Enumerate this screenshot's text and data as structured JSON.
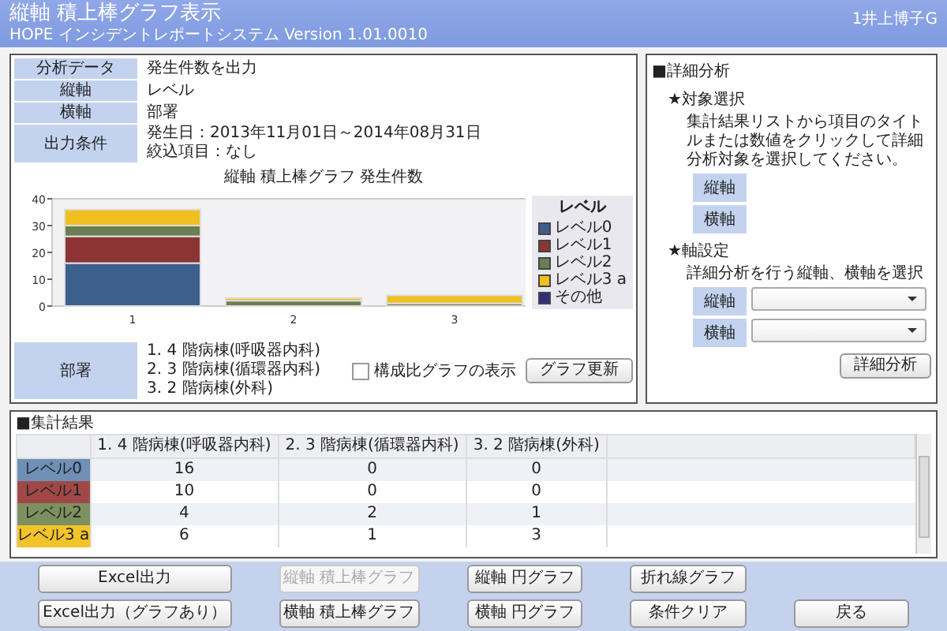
{
  "window": {
    "title": "縦軸 積上棒グラフ表示",
    "subtitle": "HOPE インシデントレポートシステム Version 1.01.0010",
    "user": "1井上博子G"
  },
  "conditions": [
    {
      "label": "分析データ",
      "lines": [
        "発生件数を出力"
      ]
    },
    {
      "label": "縦軸",
      "lines": [
        "レベル"
      ]
    },
    {
      "label": "横軸",
      "lines": [
        "部署"
      ]
    },
    {
      "label": "出力条件",
      "lines": [
        "発生日：2013年11月01日～2014年08月31日",
        "絞込項目：なし"
      ]
    }
  ],
  "chart": {
    "chart_data": {
      "type": "bar",
      "stacked": true,
      "title": "縦軸 積上棒グラフ  発生件数",
      "categories": [
        "1",
        "2",
        "3"
      ],
      "ylim": [
        0,
        40
      ],
      "yticks": [
        0,
        10,
        20,
        30,
        40
      ],
      "legend": {
        "title": "レベル"
      },
      "series": [
        {
          "name": "レベル0",
          "color": "#3d5f8c",
          "values": [
            16,
            0,
            0
          ]
        },
        {
          "name": "レベル1",
          "color": "#8c3434",
          "values": [
            10,
            0,
            0
          ]
        },
        {
          "name": "レベル2",
          "color": "#6b7e52",
          "values": [
            4,
            2,
            1
          ]
        },
        {
          "name": "レベル3 a",
          "color": "#f0c020",
          "values": [
            6,
            1,
            3
          ]
        },
        {
          "name": "その他",
          "color": "#2e2e7a",
          "values": [
            0,
            0,
            0
          ]
        }
      ]
    }
  },
  "department": {
    "label": "部署",
    "lines": [
      "1. 4 階病棟(呼吸器内科)",
      "2. 3 階病棟(循環器内科)",
      "3. 2 階病棟(外科)"
    ],
    "ratio_checkbox": {
      "label": "構成比グラフの表示",
      "checked": false
    },
    "update_button": "グラフ更新"
  },
  "detail": {
    "title": "■詳細分析",
    "target_heading": "★対象選択",
    "target_text": "集計結果リストから項目のタイトルまたは数値をクリックして詳細分析対象を選択してください。",
    "target_labels": [
      "縦軸",
      "横軸"
    ],
    "axis_heading": "★軸設定",
    "axis_text": "詳細分析を行う縦軸、横軸を選択",
    "axis_selects": [
      {
        "label": "縦軸"
      },
      {
        "label": "横軸"
      }
    ],
    "button": "詳細分析"
  },
  "results": {
    "title": "■集計結果",
    "columns": [
      "1. 4 階病棟(呼吸器内科)",
      "2. 3 階病棟(循環器内科)",
      "3. 2 階病棟(外科)"
    ],
    "rows": [
      {
        "label": "レベル0",
        "color": "#6f8fb5",
        "cells": [
          "16",
          "0",
          "0"
        ]
      },
      {
        "label": "レベル1",
        "color": "#a04848",
        "cells": [
          "10",
          "0",
          "0"
        ]
      },
      {
        "label": "レベル2",
        "color": "#7d9060",
        "cells": [
          "4",
          "2",
          "1"
        ]
      },
      {
        "label": "レベル3 a",
        "color": "#f2c42a",
        "cells": [
          "6",
          "1",
          "3"
        ]
      }
    ]
  },
  "buttons": [
    [
      {
        "label": "Excel出力",
        "disabled": false
      },
      {
        "label": "縦軸 積上棒グラフ",
        "disabled": true
      },
      {
        "label": "縦軸 円グラフ",
        "disabled": false
      },
      {
        "label": "折れ線グラフ",
        "disabled": false
      }
    ],
    [
      {
        "label": "Excel出力（グラフあり）",
        "disabled": false
      },
      {
        "label": "横軸 積上棒グラフ",
        "disabled": false
      },
      {
        "label": "横軸 円グラフ",
        "disabled": false
      },
      {
        "label": "条件クリア",
        "disabled": false
      },
      {
        "label": "戻る",
        "disabled": false
      }
    ]
  ]
}
